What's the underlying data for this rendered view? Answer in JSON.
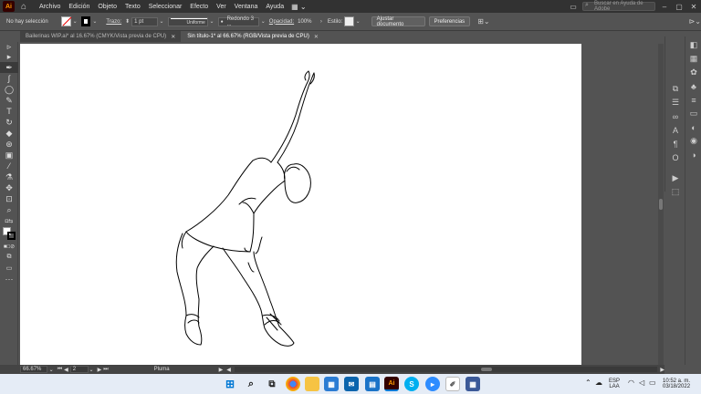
{
  "app": {
    "logo": "Ai"
  },
  "menu": [
    "Archivo",
    "Edición",
    "Objeto",
    "Texto",
    "Seleccionar",
    "Efecto",
    "Ver",
    "Ventana",
    "Ayuda"
  ],
  "search": {
    "placeholder": "Buscar en Ayuda de Adobe"
  },
  "control_bar": {
    "selection": "No hay selección",
    "stroke_label": "Trazo:",
    "stroke_weight": "1 pt",
    "profile": "Uniforme",
    "brush": "Redondo 3 ...",
    "opacity_label": "Opacidad:",
    "opacity": "100%",
    "style_label": "Estilo:",
    "document_setup": "Ajustar documento",
    "preferences": "Preferencias"
  },
  "tabs": [
    {
      "label": "Bailerinas WIP.ai* al 16.67% (CMYK/Vista previa de CPU)",
      "active": false
    },
    {
      "label": "Sin título-1* al 66.67% (RGB/Vista previa de CPU)",
      "active": true
    }
  ],
  "status": {
    "zoom": "66.67%",
    "artboard": "2",
    "tool": "Pluma"
  },
  "tray": {
    "lang1": "ESP",
    "lang2": "LAA",
    "time": "10:52 a. m.",
    "date": "03/18/2022"
  },
  "colors": {
    "accent": "#ff9a00",
    "chrome_dark": "#323232",
    "chrome": "#535353",
    "taskbar": "#e5ecf6"
  }
}
